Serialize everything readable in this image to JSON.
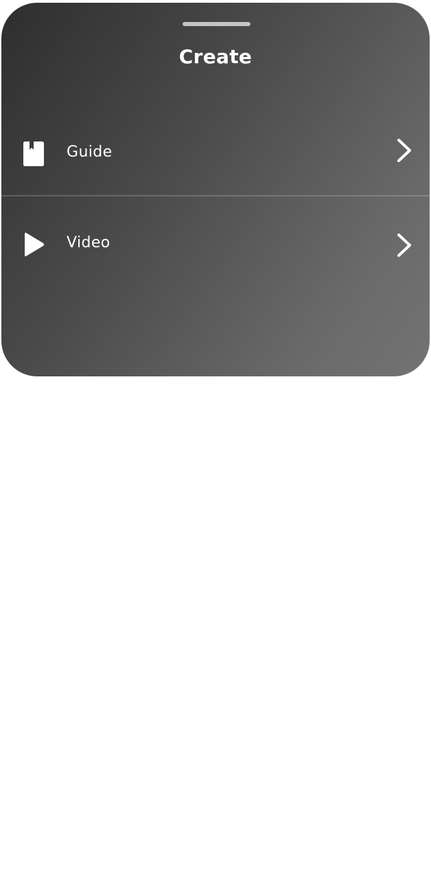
{
  "sheet": {
    "title": "Create",
    "options": [
      {
        "label": "Guide",
        "icon": "guide-book-icon"
      },
      {
        "label": "Video",
        "icon": "play-icon"
      }
    ]
  },
  "colors": {
    "gradient_start": "#2e2e2e",
    "gradient_end": "#737373",
    "text": "#ffffff",
    "handle": "#c4c4c4"
  }
}
